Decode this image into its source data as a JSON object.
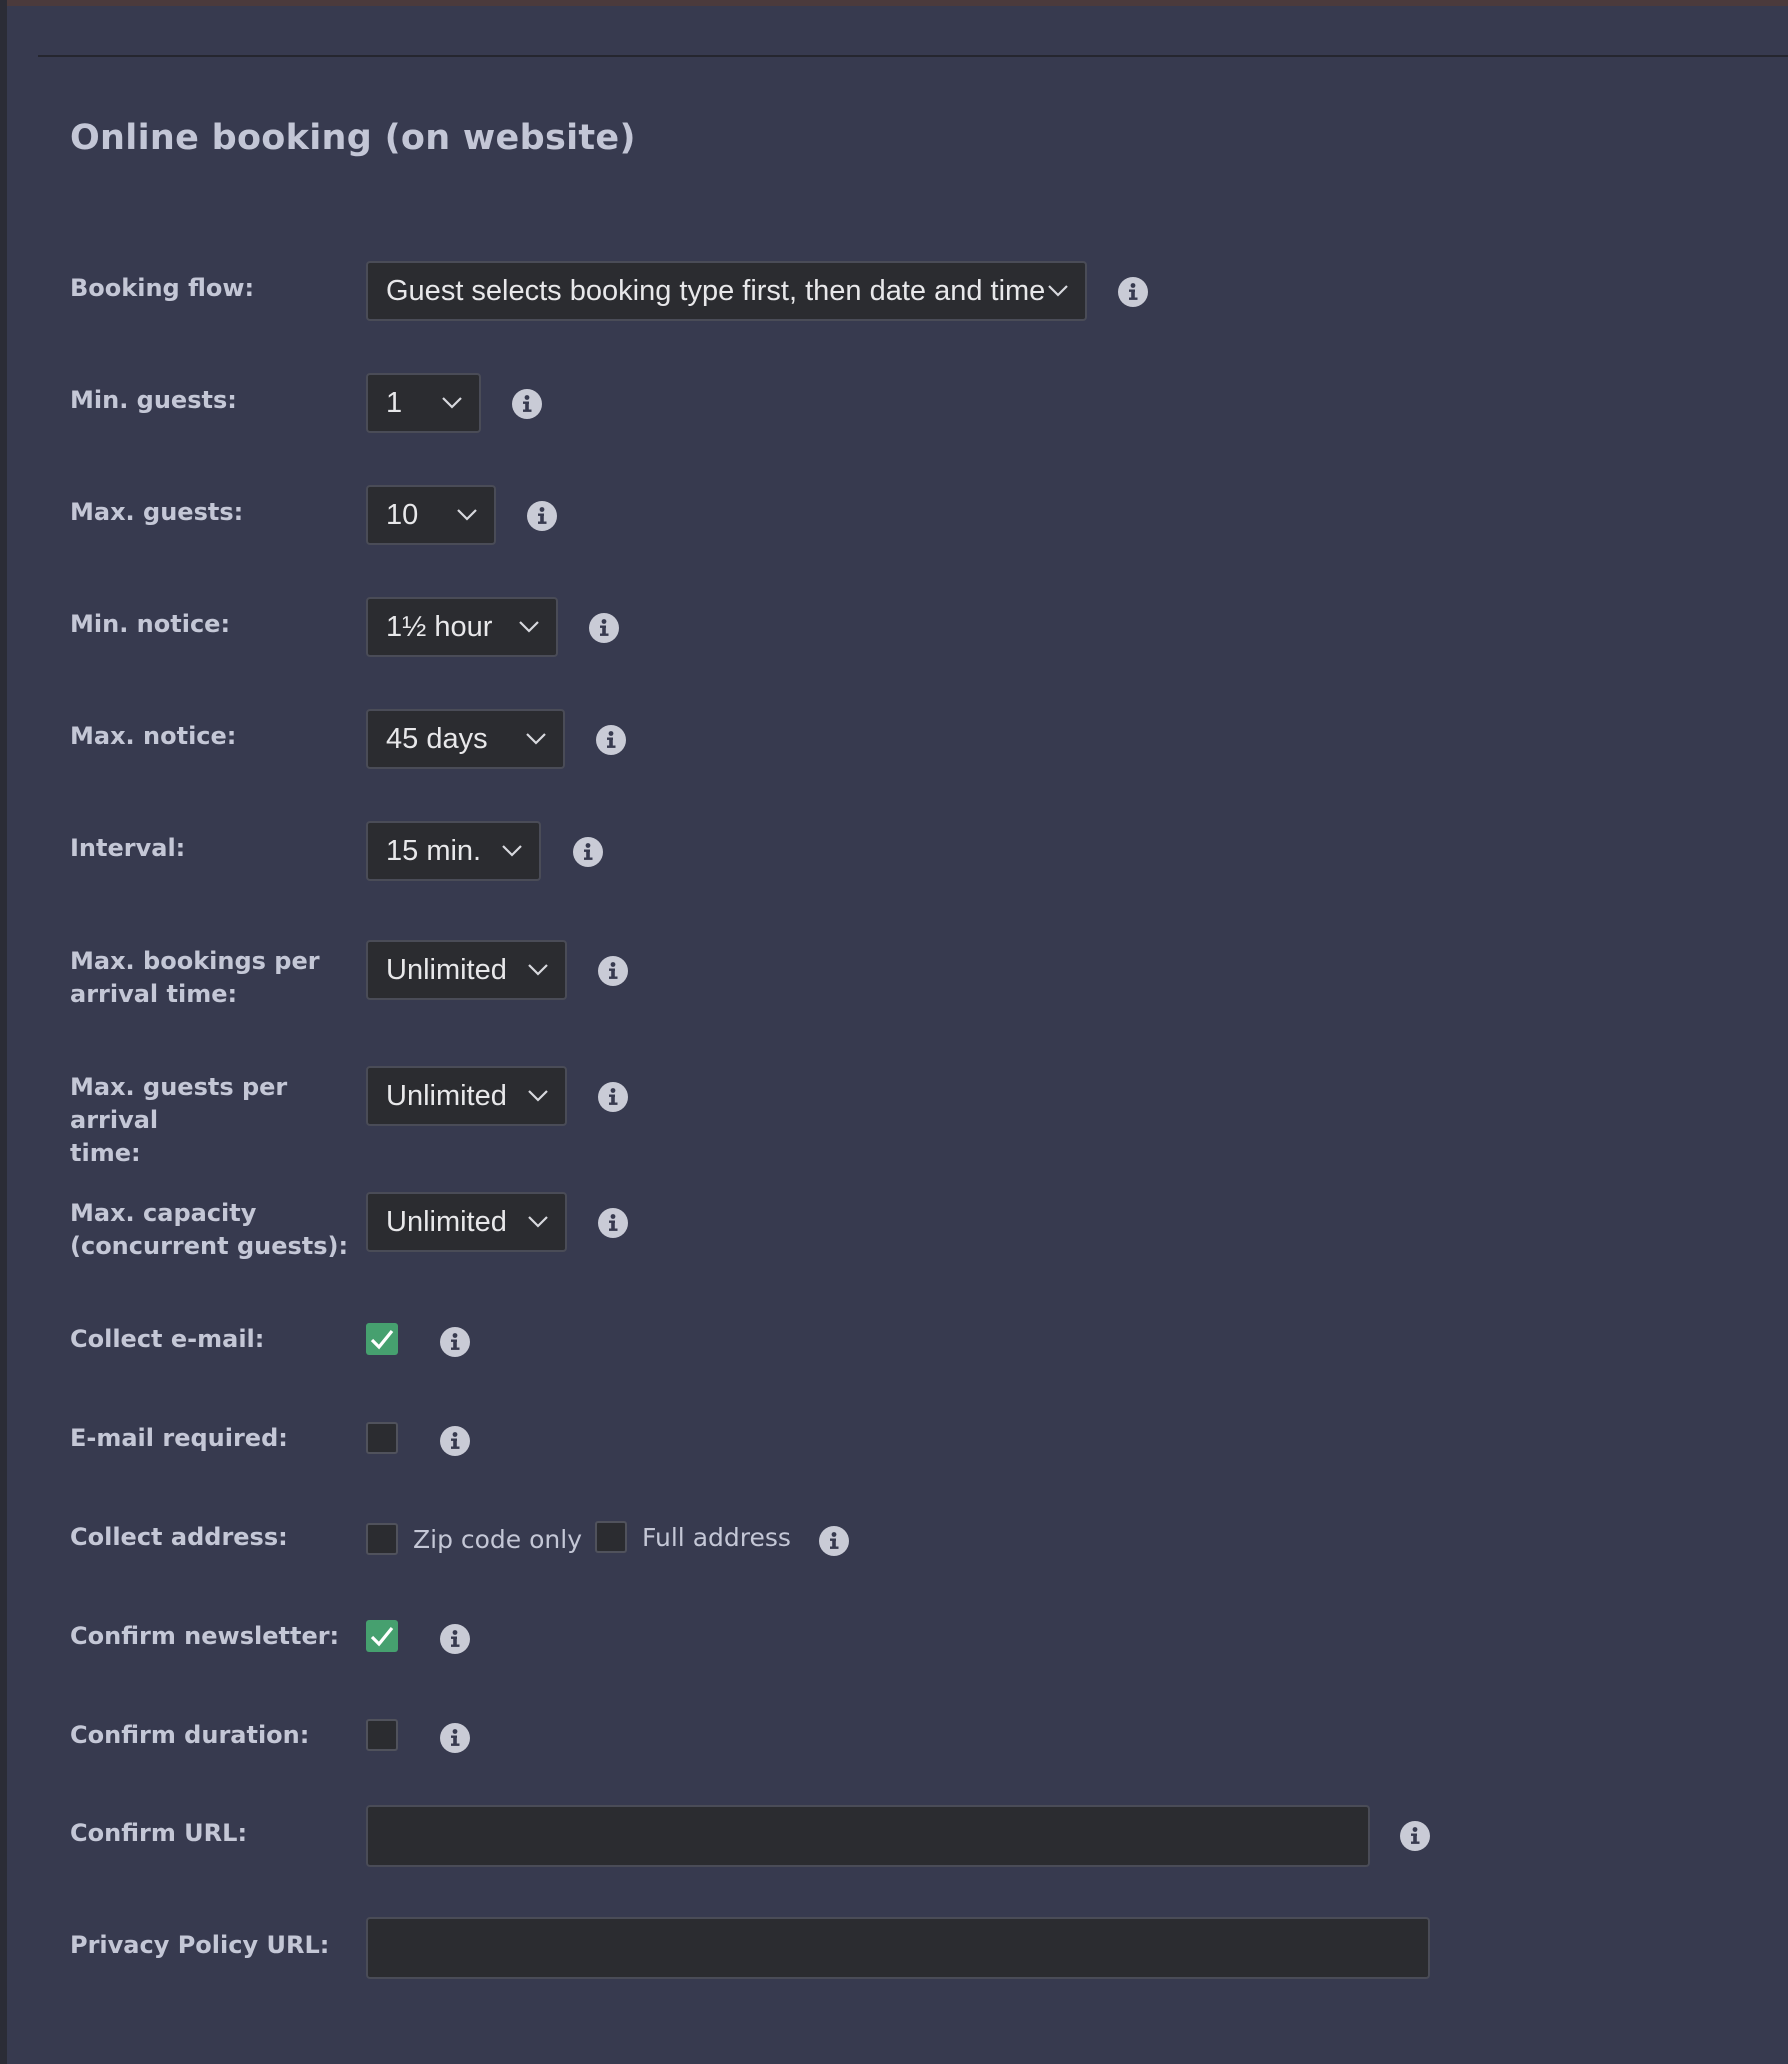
{
  "section": {
    "title": "Online booking (on website)"
  },
  "fields": {
    "booking_flow": {
      "label": "Booking flow:",
      "value": "Guest selects booking type first, then date and time"
    },
    "min_guests": {
      "label": "Min. guests:",
      "value": "1"
    },
    "max_guests": {
      "label": "Max. guests:",
      "value": "10"
    },
    "min_notice": {
      "label": "Min. notice:",
      "value": "1½ hour"
    },
    "max_notice": {
      "label": "Max. notice:",
      "value": "45 days"
    },
    "interval": {
      "label": "Interval:",
      "value": "15 min."
    },
    "max_bookings_per_arrival": {
      "label_line1": "Max. bookings per",
      "label_line2": "arrival time:",
      "value": "Unlimited"
    },
    "max_guests_per_arrival": {
      "label_line1": "Max. guests per arrival",
      "label_line2": "time:",
      "value": "Unlimited"
    },
    "max_capacity": {
      "label_line1": "Max. capacity",
      "label_line2": "(concurrent guests):",
      "value": "Unlimited"
    },
    "collect_email": {
      "label": "Collect e-mail:",
      "checked": true
    },
    "email_required": {
      "label": "E-mail required:",
      "checked": false
    },
    "collect_address": {
      "label": "Collect address:",
      "options": [
        {
          "label": "Zip code only",
          "checked": false
        },
        {
          "label": "Full address",
          "checked": false
        }
      ]
    },
    "confirm_newsletter": {
      "label": "Confirm newsletter:",
      "checked": true
    },
    "confirm_duration": {
      "label": "Confirm duration:",
      "checked": false
    },
    "confirm_url": {
      "label": "Confirm URL:",
      "value": ""
    },
    "privacy_policy_url": {
      "label": "Privacy Policy URL:",
      "value": ""
    }
  },
  "icons": {
    "info": "info-icon",
    "chevron": "chevron-down-icon",
    "check": "checkmark-icon"
  },
  "colors": {
    "background": "#373a4f",
    "control_bg": "#2b2c30",
    "checkbox_on": "#46a06f",
    "label": "#c4c7d6"
  }
}
